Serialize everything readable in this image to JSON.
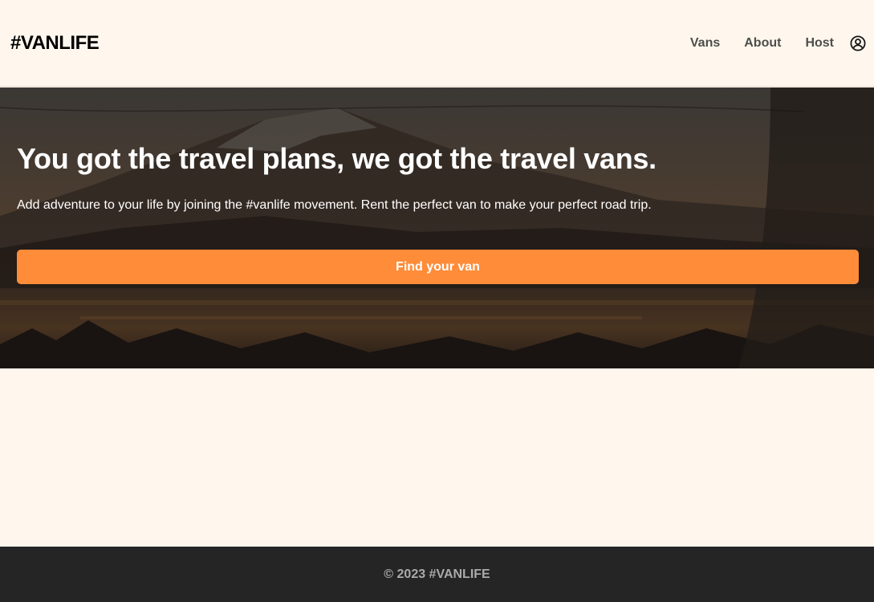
{
  "header": {
    "logo": "#VANLIFE",
    "nav": {
      "vans": "Vans",
      "about": "About",
      "host": "Host"
    },
    "profile_icon": "user-circle-icon"
  },
  "hero": {
    "title": "You got the travel plans, we got the travel vans.",
    "subtitle": "Add adventure to your life by joining the #vanlife movement. Rent the perfect van to make your perfect road trip.",
    "cta_label": "Find your van"
  },
  "footer": {
    "text": "© 2023 #VANLIFE"
  },
  "colors": {
    "background": "#FFF7ED",
    "accent": "#FF8C38",
    "footer_bg": "#252525",
    "footer_text": "#AAAAAA",
    "nav_text": "#4D4D4D"
  }
}
